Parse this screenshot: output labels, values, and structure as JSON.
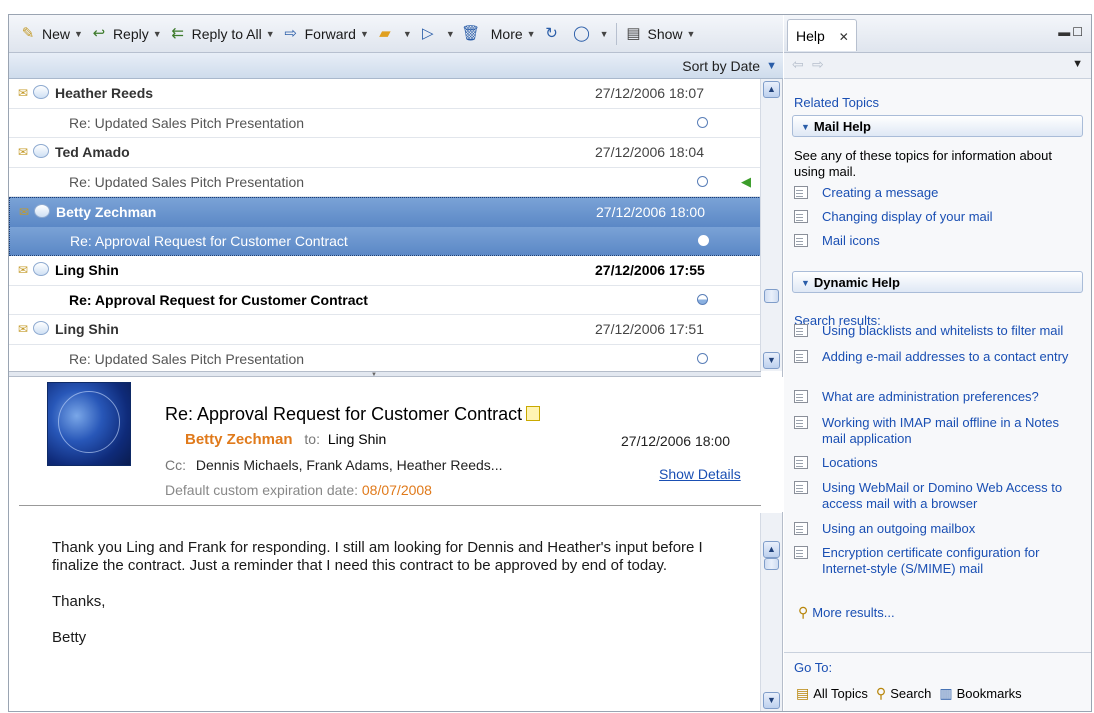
{
  "toolbar": {
    "new": "New",
    "reply": "Reply",
    "reply_all": "Reply to All",
    "forward": "Forward",
    "more": "More",
    "show": "Show"
  },
  "sort_label": "Sort by Date",
  "messages": [
    {
      "sender": "Heather Reeds",
      "date": "27/12/2006 18:07",
      "subject": "Re: Updated Sales Pitch Presentation"
    },
    {
      "sender": "Ted Amado",
      "date": "27/12/2006 18:04",
      "subject": "Re: Updated Sales Pitch Presentation"
    },
    {
      "sender": "Betty Zechman",
      "date": "27/12/2006 18:00",
      "subject": "Re: Approval Request for Customer Contract"
    },
    {
      "sender": "Ling Shin",
      "date": "27/12/2006 17:55",
      "subject": "Re: Approval Request for Customer Contract"
    },
    {
      "sender": "Ling Shin",
      "date": "27/12/2006 17:51",
      "subject": "Re: Updated Sales Pitch Presentation"
    }
  ],
  "message": {
    "subject": "Re: Approval Request for Customer Contract",
    "from": "Betty Zechman",
    "to_label": "to:",
    "to": "Ling Shin",
    "date": "27/12/2006 18:00",
    "cc_label": "Cc:",
    "cc": "Dennis Michaels, Frank Adams, Heather Reeds...",
    "show_details": "Show Details",
    "expiration_label": "Default custom expiration date:",
    "expiration_date": "08/07/2008",
    "body": [
      "Thank you Ling and Frank for responding. I still am looking for Dennis and Heather's input before I finalize the contract. Just a reminder that I need this contract to be approved by end of today.",
      "Thanks,",
      "Betty"
    ]
  },
  "help": {
    "tab_label": "Help",
    "related_topics": "Related Topics",
    "mail_help": {
      "title": "Mail Help",
      "intro": "See any of these topics for information about using mail.",
      "links": [
        "Creating a message",
        "Changing display of your mail",
        "Mail icons"
      ]
    },
    "dynamic_help": {
      "title": "Dynamic Help",
      "search_results_label": "Search results:",
      "links": [
        "Using blacklists and whitelists to filter mail",
        "Adding e-mail addresses to a contact entry",
        "What are administration preferences?",
        "Working with IMAP mail offline in a Notes mail application",
        "Locations",
        "Using WebMail or Domino Web Access to access mail with a browser",
        "Using an outgoing mailbox",
        "Encryption certificate configuration for Internet-style (S/MIME) mail"
      ],
      "more_results": "More results..."
    },
    "goto_label": "Go To:",
    "goto_links": [
      "All Topics",
      "Search",
      "Bookmarks"
    ]
  },
  "colors": {
    "selection": "#5b88c6",
    "link": "#1a4fb3",
    "accent_orange": "#e07a1b"
  }
}
